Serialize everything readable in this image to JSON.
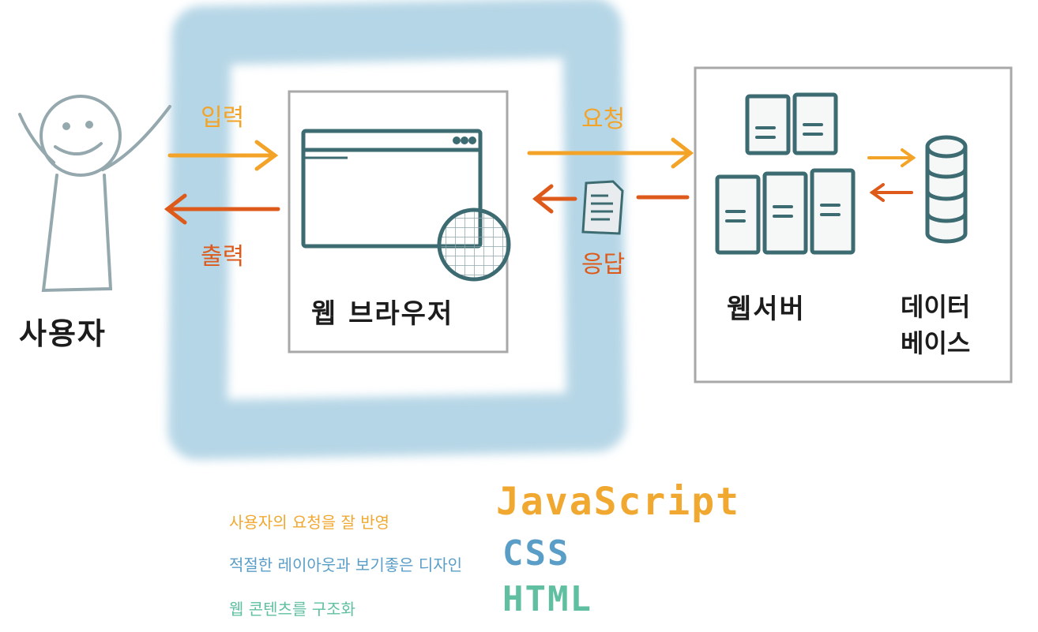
{
  "labels": {
    "user": "사용자",
    "browser": "웹 브라우저",
    "web_server": "웹서버",
    "database_line1": "데이터",
    "database_line2": "베이스"
  },
  "arrows": {
    "input": "입력",
    "output": "출력",
    "request": "요청",
    "response": "응답"
  },
  "legend": [
    {
      "description": "사용자의 요청을 잘 반영",
      "tech": "JavaScript",
      "color": "#f0a830"
    },
    {
      "description": "적절한 레이아웃과 보기좋은 디자인",
      "tech": "CSS",
      "color": "#5a9ec8"
    },
    {
      "description": "웹 콘텐츠를 구조화",
      "tech": "HTML",
      "color": "#5fbfa0"
    }
  ],
  "colors": {
    "orange": "#f3a327",
    "red_orange": "#dd5a1b",
    "teal": "#3d6b72",
    "frame": "#a8a8a8",
    "cloud": "#a9cfe2",
    "stick": "#94a8ae"
  }
}
